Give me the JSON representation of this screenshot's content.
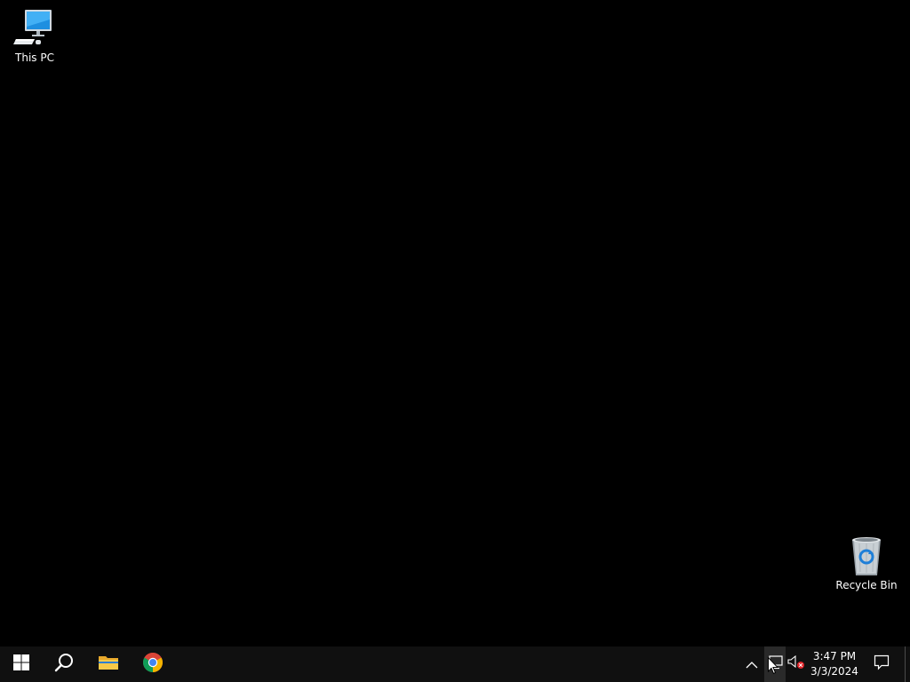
{
  "desktop": {
    "background_color": "#000000",
    "icons": [
      {
        "label": "This PC",
        "icon": "computer-icon"
      },
      {
        "label": "Recycle Bin",
        "icon": "recycle-bin-icon"
      }
    ]
  },
  "taskbar": {
    "background_color": "#101010",
    "pinned": [
      {
        "name": "Start",
        "icon": "windows-logo-icon"
      },
      {
        "name": "Search",
        "icon": "search-icon"
      },
      {
        "name": "File Explorer",
        "icon": "folder-icon"
      },
      {
        "name": "Google Chrome",
        "icon": "chrome-icon"
      }
    ],
    "tray": {
      "icons": [
        "chevron-up-icon",
        "network-icon",
        "volume-muted-icon",
        "notification-icon"
      ],
      "time": "3:47 PM",
      "date": "3/3/2024"
    }
  }
}
